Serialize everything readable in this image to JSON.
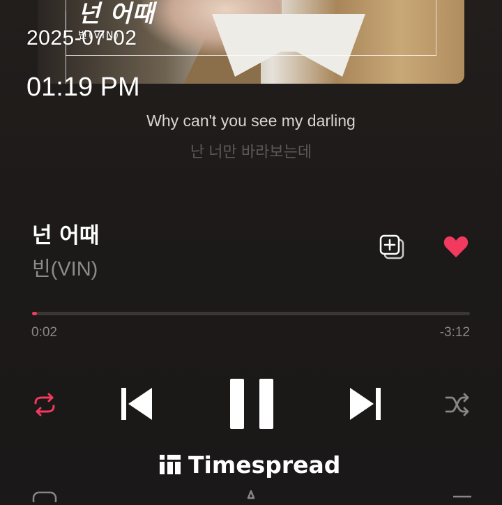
{
  "overlay": {
    "date": "2025-07-02",
    "time": "01:19 PM"
  },
  "album_art": {
    "title": "넌 어때",
    "artist": "빈(VIN)"
  },
  "lyrics": {
    "current": "Why can't you see my darling",
    "next": "난 너만 바라보는데"
  },
  "track": {
    "title": "넌 어때",
    "artist": "빈(VIN)"
  },
  "progress": {
    "elapsed": "0:02",
    "remaining": "-3:12",
    "fraction": 0.011
  },
  "icons": {
    "add_playlist": "add-to-playlist-icon",
    "like": "heart-icon",
    "repeat": "repeat-icon",
    "previous": "skip-previous-icon",
    "pause": "pause-icon",
    "next": "skip-next-icon",
    "shuffle": "shuffle-icon"
  },
  "colors": {
    "accent": "#f23a5e",
    "background": "#1c1918"
  },
  "watermark": {
    "text": "Timespread"
  }
}
